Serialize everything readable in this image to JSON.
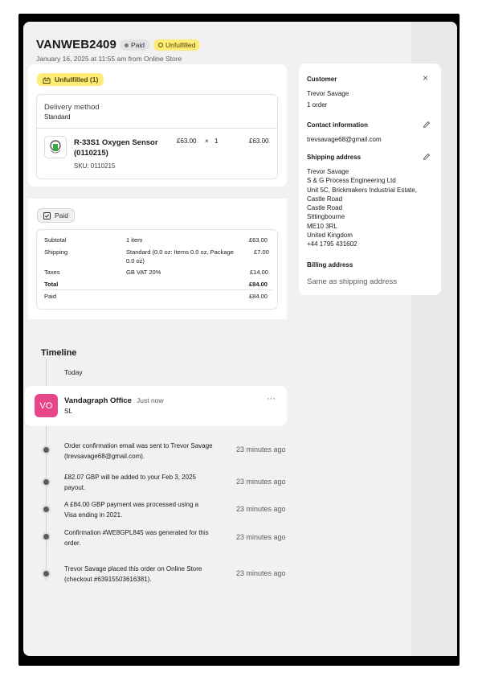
{
  "order": {
    "id": "VANWEB2409",
    "payment_status": "Paid",
    "fulfillment_status": "Unfulfilled",
    "subtitle": "January 16, 2025 at 11:55 am from Online Store"
  },
  "fulfillment": {
    "chip": "Unfulfilled (1)",
    "delivery_label": "Delivery method",
    "delivery_value": "Standard",
    "item": {
      "name_line1": "R-33S1 Oxygen Sensor",
      "name_line2": "(0110215)",
      "sku": "SKU: 0110215",
      "price": "£63.00",
      "times": "×",
      "qty": "1",
      "total": "£63.00"
    }
  },
  "payment": {
    "chip": "Paid",
    "rows": {
      "subtotal": {
        "label": "Subtotal",
        "desc": "1 item",
        "amount": "£63.00"
      },
      "shipping": {
        "label": "Shipping",
        "desc1": "Standard (0.0 oz: Items 0.0 oz, Package",
        "desc2": "0.0 oz)",
        "amount": "£7.00"
      },
      "taxes": {
        "label": "Taxes",
        "desc": "GB VAT 20%",
        "amount": "£14.00"
      },
      "total": {
        "label": "Total",
        "amount": "£84.00"
      },
      "paid": {
        "label": "Paid",
        "amount": "£84.00"
      }
    }
  },
  "customer": {
    "title": "Customer",
    "close": "×",
    "name": "Trevor Savage",
    "orders": "1 order",
    "contact_title": "Contact information",
    "email": "trevsavage68@gmail.com",
    "shipping_title": "Shipping address",
    "address": [
      "Trevor Savage",
      "S & G Process Engineering Ltd",
      "Unit 5C, Brickmakers Industrial Estate,",
      "Castle Road",
      "Castle Road",
      "Sittingbourne",
      "ME10 3RL",
      "United Kingdom",
      "+44 1795 431602"
    ],
    "billing_title": "Billing address",
    "billing_value": "Same as shipping address"
  },
  "timeline": {
    "title": "Timeline",
    "today": "Today",
    "comment": {
      "avatar": "VO",
      "author": "Vandagraph Office",
      "time": "Just now",
      "body": "SL",
      "menu": "···"
    },
    "events": [
      {
        "line1": "Order confirmation email was sent to Trevor Savage",
        "line2": "(trevsavage68@gmail.com).",
        "time": "23 minutes ago"
      },
      {
        "line1": "£82.07 GBP will be added to your Feb 3, 2025",
        "line2": "payout.",
        "time": "23 minutes ago"
      },
      {
        "line1": "A £84.00 GBP payment was processed using a",
        "line2": "Visa ending in 2021.",
        "time": "23 minutes ago"
      },
      {
        "line1": "Confirmation #WE8GPL845 was generated for this",
        "line2": "order.",
        "time": "23 minutes ago"
      },
      {
        "line1": "Trevor Savage placed this order on Online Store",
        "line2": "(checkout #63915503616381).",
        "time": "23 minutes ago"
      }
    ]
  },
  "colors": {
    "unfulfilled_bg": "#ffeb78",
    "avatar_bg": "#e8468b"
  }
}
